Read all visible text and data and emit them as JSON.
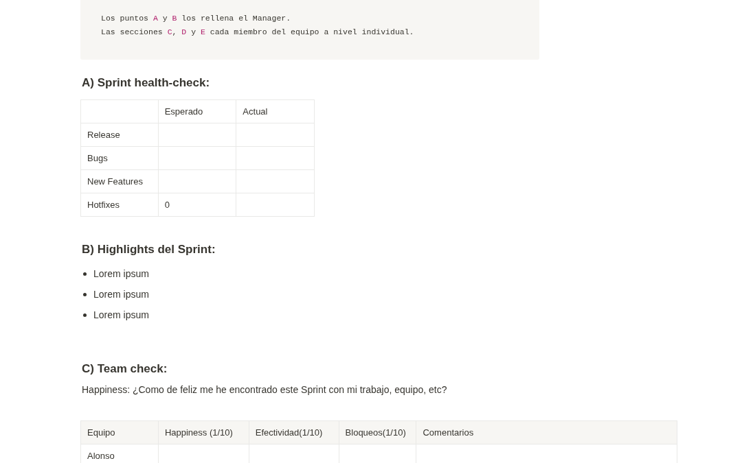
{
  "code_block": {
    "lines": [
      [
        {
          "text": "Los puntos ",
          "highlight": false
        },
        {
          "text": "A",
          "highlight": true
        },
        {
          "text": " y ",
          "highlight": false
        },
        {
          "text": "B",
          "highlight": true
        },
        {
          "text": " los rellena el Manager.",
          "highlight": false
        }
      ],
      [
        {
          "text": "Las secciones ",
          "highlight": false
        },
        {
          "text": "C",
          "highlight": true
        },
        {
          "text": ", ",
          "highlight": false
        },
        {
          "text": "D",
          "highlight": true
        },
        {
          "text": " y ",
          "highlight": false
        },
        {
          "text": "E",
          "highlight": true
        },
        {
          "text": " cada miembro del equipo a nivel individual.",
          "highlight": false
        }
      ]
    ]
  },
  "section_a": {
    "heading": "A) Sprint health-check:",
    "table": {
      "columns": [
        "",
        "Esperado",
        "Actual"
      ],
      "rows": [
        [
          "Release",
          "",
          ""
        ],
        [
          "Bugs",
          "",
          ""
        ],
        [
          "New Features",
          "",
          ""
        ],
        [
          "Hotfixes",
          "0",
          ""
        ]
      ]
    }
  },
  "section_b": {
    "heading": "B) Highlights del Sprint:",
    "bullets": [
      "Lorem ipsum",
      "Lorem ipsum",
      "Lorem ipsum"
    ]
  },
  "section_c": {
    "heading": "C) Team check:",
    "paragraph": "Happiness: ¿Como de feliz me he encontrado este Sprint con mi trabajo, equipo, etc?",
    "table": {
      "columns": [
        "Equipo",
        "Happiness (1/10)",
        "Efectividad(1/10)",
        "Bloqueos(1/10)",
        "Comentarios"
      ],
      "rows": [
        [
          "Alonso",
          "",
          "",
          "",
          ""
        ]
      ]
    }
  }
}
